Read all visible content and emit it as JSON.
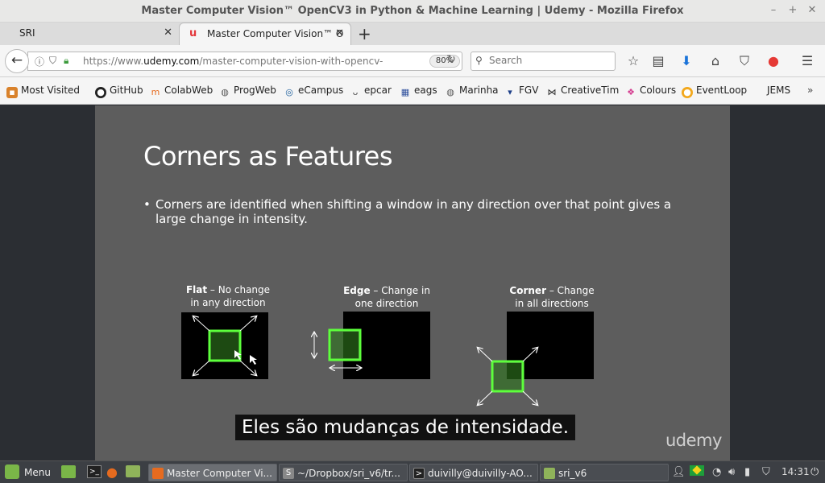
{
  "window": {
    "title": "Master Computer Vision™ OpenCV3 in Python & Machine Learning | Udemy - Mozilla Firefox",
    "buttons": [
      "–",
      "+",
      "✕"
    ]
  },
  "tabs": [
    {
      "label": "SRI",
      "active": false
    },
    {
      "label": "Master Computer Vision™ O",
      "active": true
    }
  ],
  "nav": {
    "url_prefix": "https://www.",
    "url_domain": "udemy.com",
    "url_path": "/master-computer-vision-with-opencv-in-p",
    "zoom": "80%",
    "search_placeholder": "Search"
  },
  "bookmarks": [
    {
      "label": "Most Visited",
      "icon": "folder-icon"
    },
    {
      "label": "GitHub",
      "icon": "github-icon"
    },
    {
      "label": "ColabWeb",
      "icon": "colabweb-icon"
    },
    {
      "label": "ProgWeb",
      "icon": "globe-icon"
    },
    {
      "label": "eCampus",
      "icon": "ecampus-icon"
    },
    {
      "label": "epcar",
      "icon": "epcar-icon"
    },
    {
      "label": "eags",
      "icon": "eags-icon"
    },
    {
      "label": "Marinha",
      "icon": "globe-icon"
    },
    {
      "label": "FGV",
      "icon": "fgv-icon"
    },
    {
      "label": "CreativeTim",
      "icon": "creativetim-icon"
    },
    {
      "label": "Colours",
      "icon": "colours-icon"
    },
    {
      "label": "EventLoop",
      "icon": "eventloop-icon"
    },
    {
      "label": "JEMS",
      "icon": ""
    }
  ],
  "slide": {
    "title": "Corners as Features",
    "bullet": "Corners are identified when shifting a window in any direction over that point gives a large change in intensity.",
    "panels": [
      {
        "bold": "Flat",
        "rest1": " – No change",
        "line2": "in any direction"
      },
      {
        "bold": "Edge",
        "rest1": " – Change in",
        "line2": "one direction"
      },
      {
        "bold": "Corner",
        "rest1": " – Change",
        "line2": "in all directions"
      }
    ],
    "logo": "udemy"
  },
  "subtitle": "Eles são mudanças de intensidade.",
  "taskbar": {
    "menu_label": "Menu",
    "windows": [
      {
        "label": "Master Computer Vi...",
        "active": true
      },
      {
        "label": "~/Dropbox/sri_v6/tr...",
        "active": false
      },
      {
        "label": "duivilly@duivilly-AO...",
        "active": false
      },
      {
        "label": "sri_v6",
        "active": false
      }
    ],
    "clock": "14:31"
  },
  "colors": {
    "slide_bg": "#5d5d5d",
    "highlight_green": "#5dff3c",
    "window_fill": "#1d4a12"
  }
}
